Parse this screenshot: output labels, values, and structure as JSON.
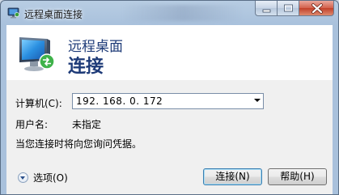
{
  "window": {
    "title": "远程桌面连接"
  },
  "caption_buttons": {
    "minimize_icon": "minimize-icon",
    "maximize_icon": "maximize-icon",
    "close_icon": "close-icon"
  },
  "banner": {
    "line1": "远程桌面",
    "line2": "连接",
    "icon": "remote-desktop-monitor-icon"
  },
  "form": {
    "computer_label": "计算机(C):",
    "computer_value": "192. 168. 0. 172",
    "username_label": "用户名:",
    "username_value": "未指定",
    "prompt": "当您连接时将向您询问凭据。"
  },
  "footer": {
    "options_label": "选项(O)",
    "connect_label": "连接(N)",
    "help_label": "帮助(H)"
  },
  "colors": {
    "frame": "#a9c1dc",
    "banner_text": "#1e3b78",
    "close_button": "#c2402a",
    "default_button_border": "#3c7fb1"
  }
}
